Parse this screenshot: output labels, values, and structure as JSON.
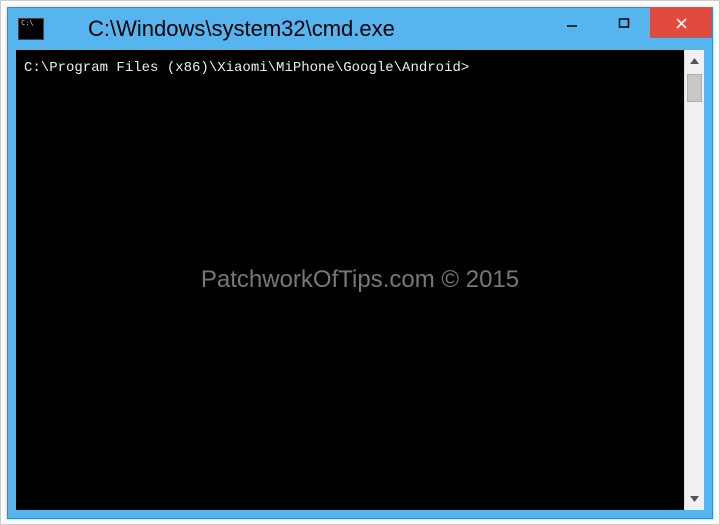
{
  "window": {
    "title": "C:\\Windows\\system32\\cmd.exe"
  },
  "console": {
    "prompt": "C:\\Program Files (x86)\\Xiaomi\\MiPhone\\Google\\Android>"
  },
  "watermark": "PatchworkOfTips.com © 2015"
}
